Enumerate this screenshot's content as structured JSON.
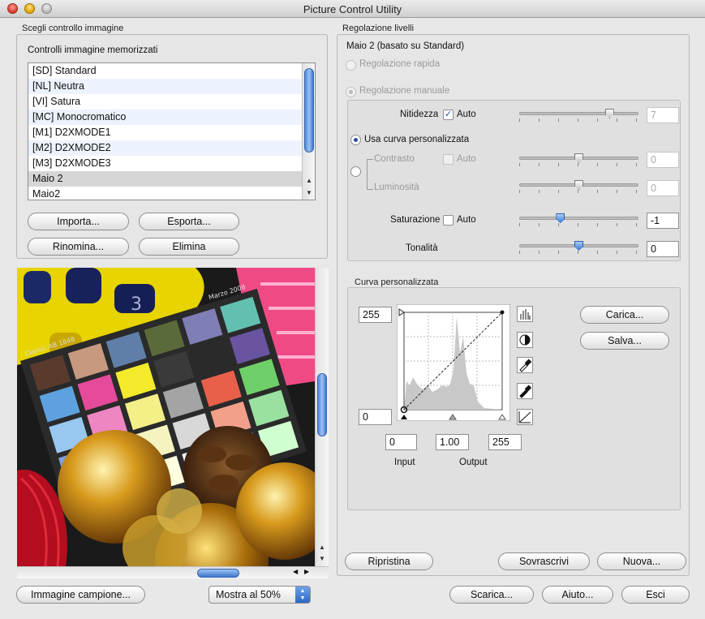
{
  "window": {
    "title": "Picture Control Utility"
  },
  "left_group": {
    "label": "Scegli controllo immagine",
    "list_label": "Controlli immagine memorizzati",
    "items": [
      {
        "label": "[SD] Standard"
      },
      {
        "label": "[NL] Neutra"
      },
      {
        "label": "[VI] Satura"
      },
      {
        "label": "[MC] Monocromatico"
      },
      {
        "label": "[M1] D2XMODE1"
      },
      {
        "label": "[M2] D2XMODE2"
      },
      {
        "label": "[M3] D2XMODE3"
      },
      {
        "label": "Maio 2",
        "selected": true
      },
      {
        "label": "Maio2"
      }
    ],
    "buttons": {
      "import": "Importa...",
      "export": "Esporta...",
      "rename": "Rinomina...",
      "delete": "Elimina"
    }
  },
  "preview": {
    "chart_label_1": "Classic AB 1848",
    "chart_label_2": "Marzo 2008",
    "sample_button": "Immagine campione...",
    "zoom_select": "Mostra al 50%"
  },
  "right_group": {
    "label": "Regolazione livelli",
    "subtitle": "Maio 2 (basato su Standard)",
    "quick_adjust": "Regolazione rapida",
    "manual_adjust": "Regolazione manuale",
    "sharpening": {
      "label": "Nitidezza",
      "auto_label": "Auto",
      "auto_checked": true,
      "value": "7",
      "level": 7,
      "max": 9
    },
    "custom_curve_option": "Usa curva personalizzata",
    "contrast": {
      "label": "Contrasto",
      "auto_label": "Auto",
      "value": "0",
      "level": 0,
      "min": -3,
      "max": 3
    },
    "brightness": {
      "label": "Luminosità",
      "value": "0",
      "level": 0,
      "min": -1,
      "max": 1
    },
    "saturation": {
      "label": "Saturazione",
      "auto_label": "Auto",
      "value": "-1",
      "level": -1,
      "min": -3,
      "max": 3
    },
    "hue": {
      "label": "Tonalità",
      "value": "0",
      "level": 0,
      "min": -3,
      "max": 3
    },
    "curve_group": {
      "label": "Curva personalizzata",
      "max_output": "255",
      "min_output": "0",
      "input_low": "0",
      "gamma": "1.00",
      "input_high": "255",
      "input_caption": "Input",
      "output_caption": "Output",
      "load_button": "Carica...",
      "save_button": "Salva..."
    },
    "reset_button": "Ripristina",
    "overwrite_button": "Sovrascrivi",
    "new_button": "Nuova..."
  },
  "footer": {
    "download_button": "Scarica...",
    "help_button": "Aiuto...",
    "quit_button": "Esci"
  }
}
